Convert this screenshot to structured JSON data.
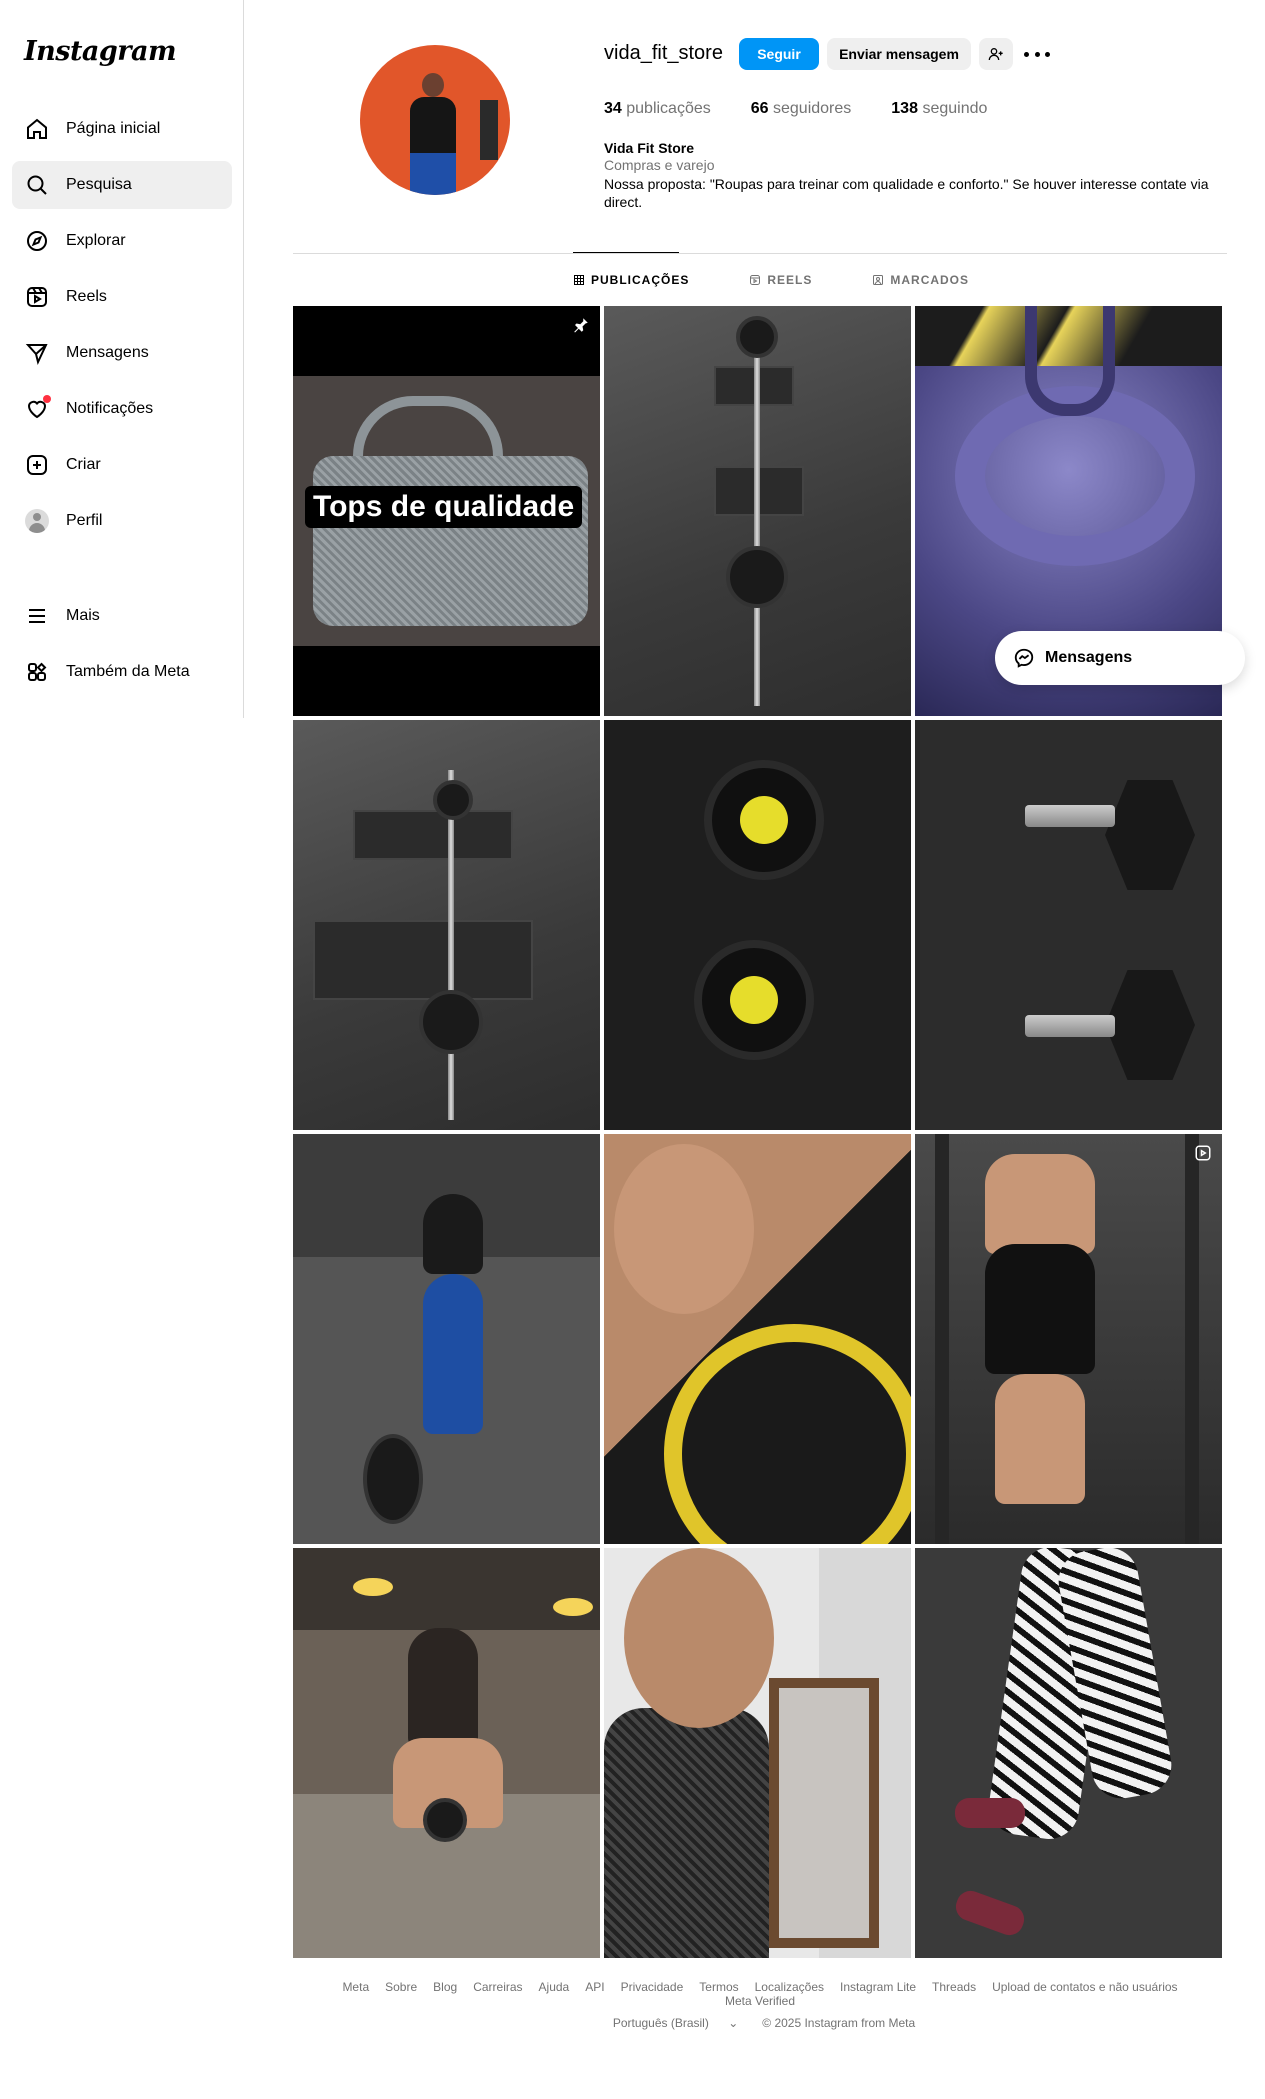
{
  "sidebar": {
    "logo": "Instagram",
    "items": [
      {
        "label": "Página inicial",
        "icon": "home-icon"
      },
      {
        "label": "Pesquisa",
        "icon": "search-icon"
      },
      {
        "label": "Explorar",
        "icon": "compass-icon"
      },
      {
        "label": "Reels",
        "icon": "reels-icon"
      },
      {
        "label": "Mensagens",
        "icon": "send-icon"
      },
      {
        "label": "Notificações",
        "icon": "heart-icon"
      },
      {
        "label": "Criar",
        "icon": "plus-square-icon"
      },
      {
        "label": "Perfil",
        "icon": "avatar"
      }
    ],
    "bottom": [
      {
        "label": "Mais",
        "icon": "menu-icon"
      },
      {
        "label": "Também da Meta",
        "icon": "meta-apps-icon"
      }
    ],
    "active_index": 1,
    "notification_dot_color": "#ff3040"
  },
  "profile": {
    "username": "vida_fit_store",
    "follow_label": "Seguir",
    "message_label": "Enviar mensagem",
    "stats": {
      "posts_count": "34",
      "posts_label": "publicações",
      "followers_count": "66",
      "followers_label": "seguidores",
      "following_count": "138",
      "following_label": "seguindo"
    },
    "bio": {
      "name": "Vida Fit Store",
      "category": "Compras e varejo",
      "text": "Nossa proposta: \"Roupas para treinar com qualidade e conforto.\" Se houver interesse contate via direct."
    },
    "accent_color": "#0095f6"
  },
  "tabs": [
    {
      "label": "PUBLICAÇÕES",
      "icon": "grid-icon",
      "active": true
    },
    {
      "label": "REELS",
      "icon": "reels-icon",
      "active": false
    },
    {
      "label": "MARCADOS",
      "icon": "tagged-icon",
      "active": false
    }
  ],
  "posts": {
    "pinned_title": "Tops de qualidade"
  },
  "floating_messages": {
    "label": "Mensagens"
  },
  "footer": {
    "links": [
      "Meta",
      "Sobre",
      "Blog",
      "Carreiras",
      "Ajuda",
      "API",
      "Privacidade",
      "Termos",
      "Localizações",
      "Instagram Lite",
      "Threads",
      "Upload de contatos e não usuários",
      "Meta Verified"
    ],
    "language": "Português (Brasil)",
    "copyright": "© 2025 Instagram from Meta"
  }
}
